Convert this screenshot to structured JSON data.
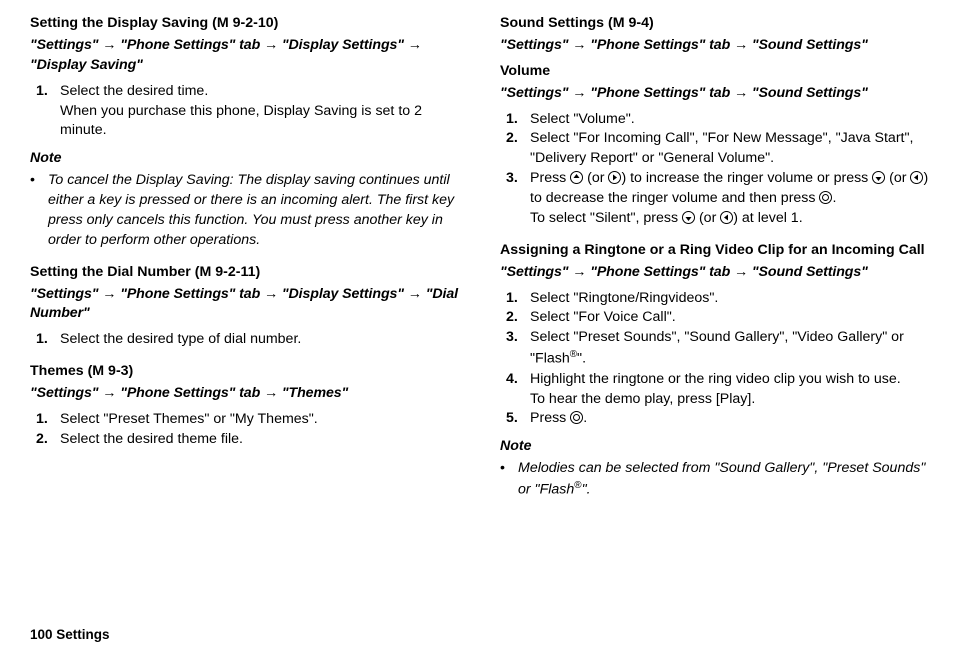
{
  "left": {
    "sec1": {
      "title_a": "Setting the Display Saving",
      "title_b": " (M 9-2-10)",
      "path": "\"Settings\" → \"Phone Settings\" tab → \"Display Settings\" → \"Display Saving\"",
      "step1_num": "1.",
      "step1_a": "Select the desired time.",
      "step1_b": "When you purchase this phone, Display Saving is set to 2 minute.",
      "note_label": "Note",
      "note1": "To cancel the Display Saving: The display saving continues until either a key is pressed or there is an incoming alert. The first key press only cancels this function. You must press another key in order to perform other operations."
    },
    "sec2": {
      "title_a": "Setting the Dial Number",
      "title_b": " (M 9-2-11)",
      "path": "\"Settings\" → \"Phone Settings\" tab → \"Display Settings\" → \"Dial Number\"",
      "step1_num": "1.",
      "step1_a": "Select the desired type of dial number."
    },
    "sec3": {
      "title_a": "Themes",
      "title_b": " (M 9-3)",
      "path": "\"Settings\" → \"Phone Settings\" tab → \"Themes\"",
      "step1_num": "1.",
      "step1_a": "Select \"Preset Themes\" or \"My Themes\".",
      "step2_num": "2.",
      "step2_a": "Select the desired theme file."
    }
  },
  "right": {
    "sec1": {
      "title_a": "Sound Settings",
      "title_b": " (M 9-4)",
      "path": "\"Settings\" → \"Phone Settings\" tab → \"Sound Settings\""
    },
    "sec2": {
      "title": "Volume",
      "path": "\"Settings\" → \"Phone Settings\" tab → \"Sound Settings\"",
      "step1_num": "1.",
      "step1_a": "Select \"Volume\".",
      "step2_num": "2.",
      "step2_a": "Select \"For Incoming Call\", \"For New Message\", \"Java Start\", \"Delivery Report\" or \"General Volume\".",
      "step3_num": "3.",
      "step3_a": "Press ",
      "step3_b": " (or ",
      "step3_c": ") to increase the ringer volume or press ",
      "step3_d": " (or ",
      "step3_e": ") to decrease the ringer volume and then press ",
      "step3_f": ".",
      "step3_g": "To select \"Silent\", press ",
      "step3_h": " (or ",
      "step3_i": ") at level 1."
    },
    "sec3": {
      "title": "Assigning a Ringtone or a Ring Video Clip for an Incoming Call",
      "path": "\"Settings\" → \"Phone Settings\" tab → \"Sound Settings\"",
      "step1_num": "1.",
      "step1_a": "Select \"Ringtone/Ringvideos\".",
      "step2_num": "2.",
      "step2_a": "Select \"For Voice Call\".",
      "step3_num": "3.",
      "step3_a": "Select \"Preset Sounds\", \"Sound Gallery\", \"Video Gallery\" or \"Flash",
      "step3_b": "\".",
      "step4_num": "4.",
      "step4_a": "Highlight the ringtone or the ring video clip you wish to use.",
      "step4_b": "To hear the demo play, press [Play].",
      "step5_num": "5.",
      "step5_a": "Press ",
      "step5_b": ".",
      "note_label": "Note",
      "note1_a": "Melodies can be selected from \"Sound Gallery\", \"Preset Sounds\" or \"Flash",
      "note1_b": "\"."
    }
  },
  "footer": "100   Settings",
  "glyphs": {
    "reg": "®"
  }
}
